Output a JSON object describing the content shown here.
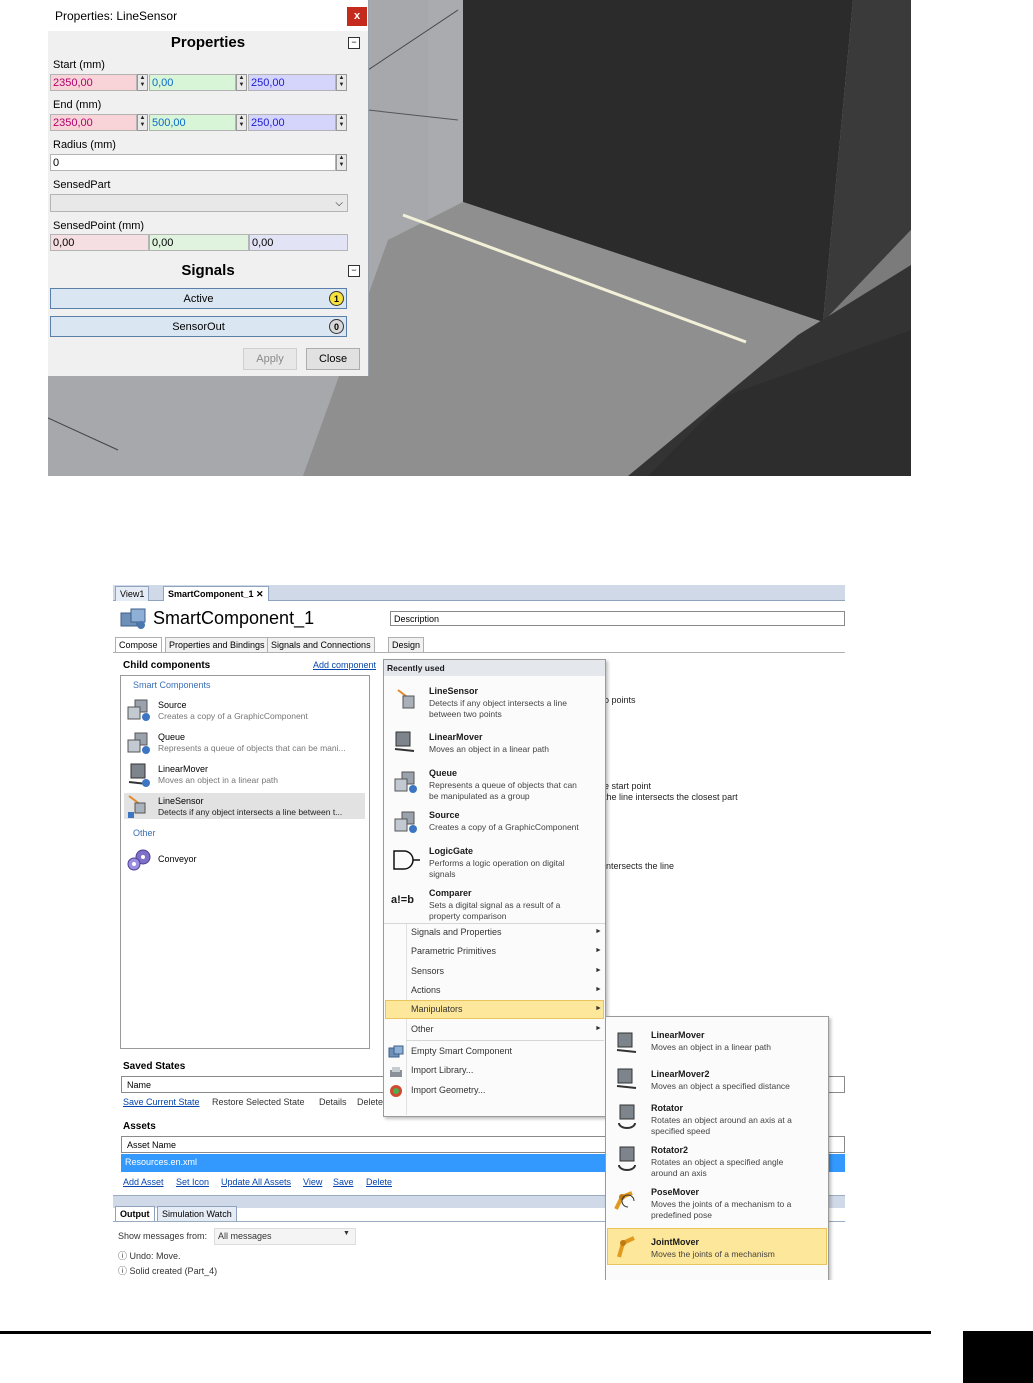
{
  "properties_window": {
    "title": "Properties: LineSensor",
    "close_glyph": "x",
    "section_properties": "Properties",
    "section_signals": "Signals",
    "start_label": "Start (mm)",
    "start": [
      "2350,00",
      "0,00",
      "250,00"
    ],
    "end_label": "End (mm)",
    "end": [
      "2350,00",
      "500,00",
      "250,00"
    ],
    "radius_label": "Radius (mm)",
    "radius": "0",
    "sensed_part_label": "SensedPart",
    "sensed_part_value": "",
    "sensed_point_label": "SensedPoint (mm)",
    "sensed_point": [
      "0,00",
      "0,00",
      "0,00"
    ],
    "signals": [
      {
        "name": "Active",
        "value": "1",
        "color": "#f7e13a"
      },
      {
        "name": "SensorOut",
        "value": "0",
        "color": "#d8d8d8"
      }
    ],
    "apply_label": "Apply",
    "close_label": "Close",
    "collapse_glyph": "−"
  },
  "smart_component": {
    "doc_tabs": [
      "View1",
      "SmartComponent_1"
    ],
    "tab_close_glyph": "✕",
    "title": "SmartComponent_1",
    "description_placeholder": "Description",
    "tabs": [
      "Compose",
      "Properties and Bindings",
      "Signals and Connections",
      "Design"
    ],
    "child_components_header": "Child components",
    "add_component_link": "Add component",
    "groups": {
      "smart": "Smart Components",
      "other": "Other"
    },
    "children": [
      {
        "name": "Source",
        "desc": "Creates a copy of a GraphicComponent"
      },
      {
        "name": "Queue",
        "desc": "Represents a queue of objects that can be mani..."
      },
      {
        "name": "LinearMover",
        "desc": "Moves an object in a linear path"
      },
      {
        "name": "LineSensor",
        "desc": "Detects if any object intersects a line between t..."
      }
    ],
    "other_children": [
      {
        "name": "Conveyor"
      }
    ],
    "background_texts": [
      "o points",
      "e start point",
      "the line intersects the closest part",
      "intersects the line"
    ],
    "saved_states_header": "Saved States",
    "saved_states_column": "Name",
    "saved_states_links": [
      "Save Current State",
      "Restore Selected State",
      "Details",
      "Delete"
    ],
    "assets_header": "Assets",
    "assets_column": "Asset Name",
    "assets_selected": "Resources.en.xml",
    "assets_links": [
      "Add Asset",
      "Set Icon",
      "Update All Assets",
      "View",
      "Save",
      "Delete"
    ],
    "output_tabs": [
      "Output",
      "Simulation Watch"
    ],
    "show_messages_label": "Show messages from:",
    "show_messages_value": "All messages",
    "messages": [
      "Undo: Move.",
      "Solid created (Part_4)"
    ]
  },
  "add_component_menu": {
    "recently_used_header": "Recently used",
    "recent": [
      {
        "name": "LineSensor",
        "desc": [
          "Detects if any object intersects a line",
          "between two points"
        ],
        "icon": "line-sensor-icon"
      },
      {
        "name": "LinearMover",
        "desc": [
          "Moves an object in a linear path"
        ],
        "icon": "linear-mover-icon"
      },
      {
        "name": "Queue",
        "desc": [
          "Represents a queue of objects that can",
          "be manipulated as a group"
        ],
        "icon": "queue-icon"
      },
      {
        "name": "Source",
        "desc": [
          "Creates a copy of a GraphicComponent"
        ],
        "icon": "source-icon"
      },
      {
        "name": "LogicGate",
        "desc": [
          "Performs a logic operation on digital",
          "signals"
        ],
        "icon": "logic-gate-icon"
      },
      {
        "name": "Comparer",
        "desc": [
          "Sets a digital signal as a result of a",
          "property comparison"
        ],
        "icon": "comparer-icon"
      }
    ],
    "comparer_icon_text": "a!=b",
    "categories": [
      "Signals and Properties",
      "Parametric Primitives",
      "Sensors",
      "Actions",
      "Manipulators",
      "Other"
    ],
    "highlighted_category": "Manipulators",
    "bottom_items": [
      "Empty Smart Component",
      "Import Library...",
      "Import Geometry..."
    ],
    "arrow_glyph": "►"
  },
  "manipulators_menu": {
    "items": [
      {
        "name": "LinearMover",
        "desc": [
          "Moves an object in a linear path"
        ]
      },
      {
        "name": "LinearMover2",
        "desc": [
          "Moves an object a specified distance"
        ]
      },
      {
        "name": "Rotator",
        "desc": [
          "Rotates an object around an axis at a",
          "specified speed"
        ]
      },
      {
        "name": "Rotator2",
        "desc": [
          "Rotates an object a specified angle",
          "around an axis"
        ]
      },
      {
        "name": "PoseMover",
        "desc": [
          "Moves the joints of a mechanism to a",
          "predefined pose"
        ]
      },
      {
        "name": "JointMover",
        "desc": [
          "Moves the joints of a mechanism"
        ]
      }
    ],
    "highlighted_item": "JointMover"
  }
}
